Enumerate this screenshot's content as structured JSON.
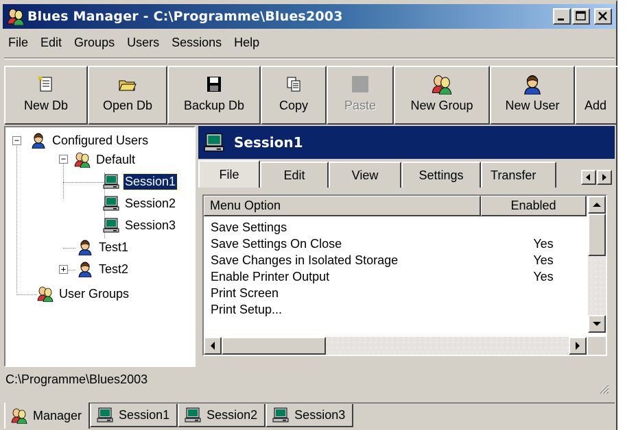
{
  "window": {
    "title": "Blues Manager - C:\\Programme\\Blues2003"
  },
  "menubar": [
    "File",
    "Edit",
    "Groups",
    "Users",
    "Sessions",
    "Help"
  ],
  "toolbar": [
    {
      "label": "New Db",
      "icon": "new-db-icon",
      "disabled": false
    },
    {
      "label": "Open Db",
      "icon": "open-folder-icon",
      "disabled": false
    },
    {
      "label": "Backup Db",
      "icon": "floppy-disk-icon",
      "disabled": false
    },
    {
      "label": "Copy",
      "icon": "copy-icon",
      "disabled": false
    },
    {
      "label": "Paste",
      "icon": "paste-icon",
      "disabled": true
    },
    {
      "label": "New Group",
      "icon": "group-icon",
      "disabled": false
    },
    {
      "label": "New User",
      "icon": "user-icon",
      "disabled": false
    },
    {
      "label": "Add",
      "icon": "add-icon",
      "disabled": false
    }
  ],
  "tree": {
    "root": "Configured Users",
    "group": "Default",
    "sessions": [
      "Session1",
      "Session2",
      "Session3"
    ],
    "selected": "Session1",
    "users": [
      "Test1",
      "Test2"
    ],
    "user_groups": "User Groups"
  },
  "session_panel": {
    "title": "Session1",
    "tabs": [
      "File",
      "Edit",
      "View",
      "Settings",
      "Transfer"
    ],
    "active_tab": "File",
    "columns": [
      "Menu Option",
      "Enabled"
    ],
    "rows": [
      {
        "option": "Save Settings",
        "enabled": ""
      },
      {
        "option": "Save Settings On Close",
        "enabled": "Yes"
      },
      {
        "option": "Save Changes in Isolated Storage",
        "enabled": "Yes"
      },
      {
        "option": "Enable Printer Output",
        "enabled": "Yes"
      },
      {
        "option": "Print Screen",
        "enabled": ""
      },
      {
        "option": "Print Setup...",
        "enabled": ""
      }
    ]
  },
  "status": {
    "path": "C:\\Programme\\Blues2003"
  },
  "bottom_tabs": [
    {
      "label": "Manager",
      "icon": "group-icon",
      "active": true
    },
    {
      "label": "Session1",
      "icon": "monitor-icon",
      "active": false
    },
    {
      "label": "Session2",
      "icon": "monitor-icon",
      "active": false
    },
    {
      "label": "Session3",
      "icon": "monitor-icon",
      "active": false
    }
  ],
  "colors": {
    "titlebar": "#0a246a",
    "face": "#d4d0c8",
    "selection": "#0a246a"
  }
}
